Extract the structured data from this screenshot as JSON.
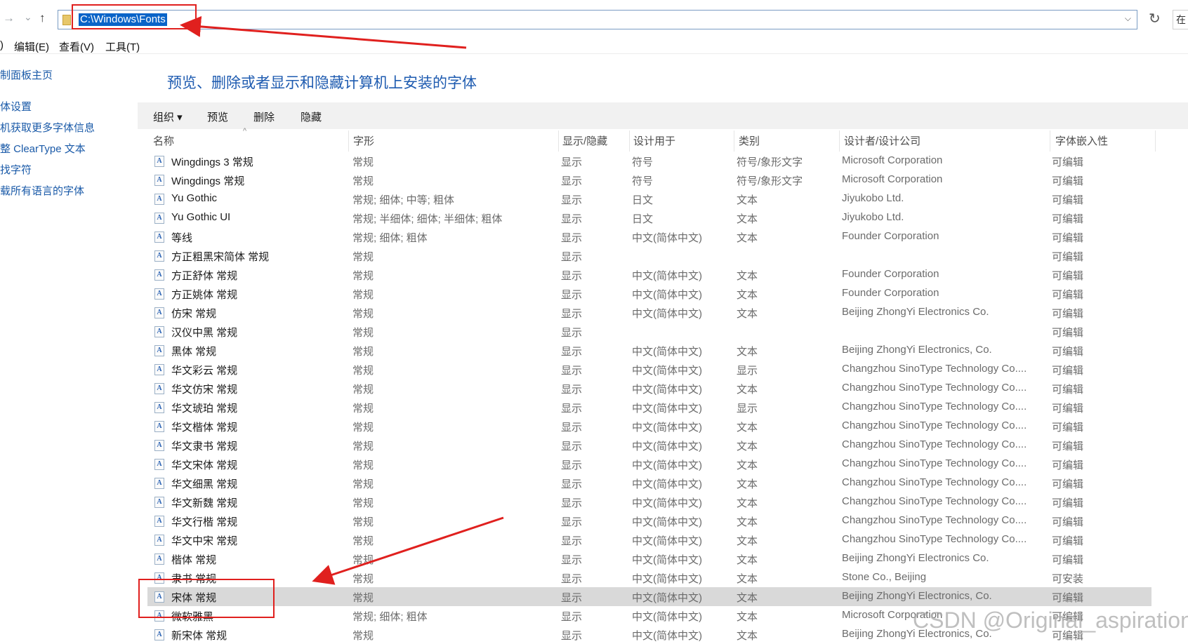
{
  "nav": {
    "back_icon": "←",
    "forward_icon": "→",
    "recent_icon": "⌄",
    "up_icon": "↑",
    "address": "C:\\Windows\\Fonts",
    "dropdown_icon": "⌵",
    "refresh_icon": "↻",
    "search_stub": "在"
  },
  "menu": [
    "编辑(E)",
    "查看(V)",
    "工具(T)"
  ],
  "menu_left_fragment": ")",
  "sidebar": [
    "制面板主页",
    "体设置",
    "机获取更多字体信息",
    "整 ClearType 文本",
    "找字符",
    "载所有语言的字体"
  ],
  "heading": "预览、删除或者显示和隐藏计算机上安装的字体",
  "toolbar": {
    "organize": "组织 ▾",
    "preview": "预览",
    "delete": "删除",
    "hide": "隐藏"
  },
  "columns": [
    "名称",
    "字形",
    "显示/隐藏",
    "设计用于",
    "类别",
    "设计者/设计公司",
    "字体嵌入性"
  ],
  "sort_icon": "^",
  "font_icon_glyph": "A",
  "rows": [
    {
      "name": "Wingdings 3 常规",
      "style": "常规",
      "show": "显示",
      "for": "符号",
      "cat": "符号/象形文字",
      "designer": "Microsoft Corporation",
      "embed": "可编辑"
    },
    {
      "name": "Wingdings 常规",
      "style": "常规",
      "show": "显示",
      "for": "符号",
      "cat": "符号/象形文字",
      "designer": "Microsoft Corporation",
      "embed": "可编辑"
    },
    {
      "name": "Yu Gothic",
      "style": "常规; 细体; 中等; 粗体",
      "show": "显示",
      "for": "日文",
      "cat": "文本",
      "designer": "Jiyukobo Ltd.",
      "embed": "可编辑"
    },
    {
      "name": "Yu Gothic UI",
      "style": "常规; 半细体; 细体; 半细体; 粗体",
      "show": "显示",
      "for": "日文",
      "cat": "文本",
      "designer": "Jiyukobo Ltd.",
      "embed": "可编辑"
    },
    {
      "name": "等线",
      "style": "常规; 细体; 粗体",
      "show": "显示",
      "for": "中文(简体中文)",
      "cat": "文本",
      "designer": "Founder Corporation",
      "embed": "可编辑"
    },
    {
      "name": "方正粗黑宋简体 常规",
      "style": "常规",
      "show": "显示",
      "for": "",
      "cat": "",
      "designer": "",
      "embed": "可编辑"
    },
    {
      "name": "方正舒体 常规",
      "style": "常规",
      "show": "显示",
      "for": "中文(简体中文)",
      "cat": "文本",
      "designer": "Founder Corporation",
      "embed": "可编辑"
    },
    {
      "name": "方正姚体 常规",
      "style": "常规",
      "show": "显示",
      "for": "中文(简体中文)",
      "cat": "文本",
      "designer": "Founder Corporation",
      "embed": "可编辑"
    },
    {
      "name": "仿宋 常规",
      "style": "常规",
      "show": "显示",
      "for": "中文(简体中文)",
      "cat": "文本",
      "designer": "Beijing ZhongYi Electronics Co.",
      "embed": "可编辑"
    },
    {
      "name": "汉仪中黑 常规",
      "style": "常规",
      "show": "显示",
      "for": "",
      "cat": "",
      "designer": "",
      "embed": "可编辑"
    },
    {
      "name": "黑体 常规",
      "style": "常规",
      "show": "显示",
      "for": "中文(简体中文)",
      "cat": "文本",
      "designer": "Beijing ZhongYi Electronics, Co.",
      "embed": "可编辑"
    },
    {
      "name": "华文彩云 常规",
      "style": "常规",
      "show": "显示",
      "for": "中文(简体中文)",
      "cat": "显示",
      "designer": "Changzhou SinoType Technology Co....",
      "embed": "可编辑"
    },
    {
      "name": "华文仿宋 常规",
      "style": "常规",
      "show": "显示",
      "for": "中文(简体中文)",
      "cat": "文本",
      "designer": "Changzhou SinoType Technology Co....",
      "embed": "可编辑"
    },
    {
      "name": "华文琥珀 常规",
      "style": "常规",
      "show": "显示",
      "for": "中文(简体中文)",
      "cat": "显示",
      "designer": "Changzhou SinoType Technology Co....",
      "embed": "可编辑"
    },
    {
      "name": "华文楷体 常规",
      "style": "常规",
      "show": "显示",
      "for": "中文(简体中文)",
      "cat": "文本",
      "designer": "Changzhou SinoType Technology Co....",
      "embed": "可编辑"
    },
    {
      "name": "华文隶书 常规",
      "style": "常规",
      "show": "显示",
      "for": "中文(简体中文)",
      "cat": "文本",
      "designer": "Changzhou SinoType Technology Co....",
      "embed": "可编辑"
    },
    {
      "name": "华文宋体 常规",
      "style": "常规",
      "show": "显示",
      "for": "中文(简体中文)",
      "cat": "文本",
      "designer": "Changzhou SinoType Technology Co....",
      "embed": "可编辑"
    },
    {
      "name": "华文细黑 常规",
      "style": "常规",
      "show": "显示",
      "for": "中文(简体中文)",
      "cat": "文本",
      "designer": "Changzhou SinoType Technology Co....",
      "embed": "可编辑"
    },
    {
      "name": "华文新魏 常规",
      "style": "常规",
      "show": "显示",
      "for": "中文(简体中文)",
      "cat": "文本",
      "designer": "Changzhou SinoType Technology Co....",
      "embed": "可编辑"
    },
    {
      "name": "华文行楷 常规",
      "style": "常规",
      "show": "显示",
      "for": "中文(简体中文)",
      "cat": "文本",
      "designer": "Changzhou SinoType Technology Co....",
      "embed": "可编辑"
    },
    {
      "name": "华文中宋 常规",
      "style": "常规",
      "show": "显示",
      "for": "中文(简体中文)",
      "cat": "文本",
      "designer": "Changzhou SinoType Technology Co....",
      "embed": "可编辑"
    },
    {
      "name": "楷体 常规",
      "style": "常规",
      "show": "显示",
      "for": "中文(简体中文)",
      "cat": "文本",
      "designer": "Beijing ZhongYi Electronics Co.",
      "embed": "可编辑"
    },
    {
      "name": "隶书 常规",
      "style": "常规",
      "show": "显示",
      "for": "中文(简体中文)",
      "cat": "文本",
      "designer": "Stone Co., Beijing",
      "embed": "可安装"
    },
    {
      "name": "宋体 常规",
      "style": "常规",
      "show": "显示",
      "for": "中文(简体中文)",
      "cat": "文本",
      "designer": "Beijing ZhongYi Electronics, Co.",
      "embed": "可编辑",
      "selected": true
    },
    {
      "name": "微软雅黑",
      "style": "常规; 细体; 粗体",
      "show": "显示",
      "for": "中文(简体中文)",
      "cat": "文本",
      "designer": "Microsoft Corporation",
      "embed": "可编辑"
    },
    {
      "name": "新宋体 常规",
      "style": "常规",
      "show": "显示",
      "for": "中文(简体中文)",
      "cat": "文本",
      "designer": "Beijing ZhongYi Electronics, Co.",
      "embed": "可编辑"
    }
  ],
  "annotation_color": "#e0201e",
  "selection_color": "#d9d9d9",
  "watermark": "CSDN @Original_aspiration"
}
